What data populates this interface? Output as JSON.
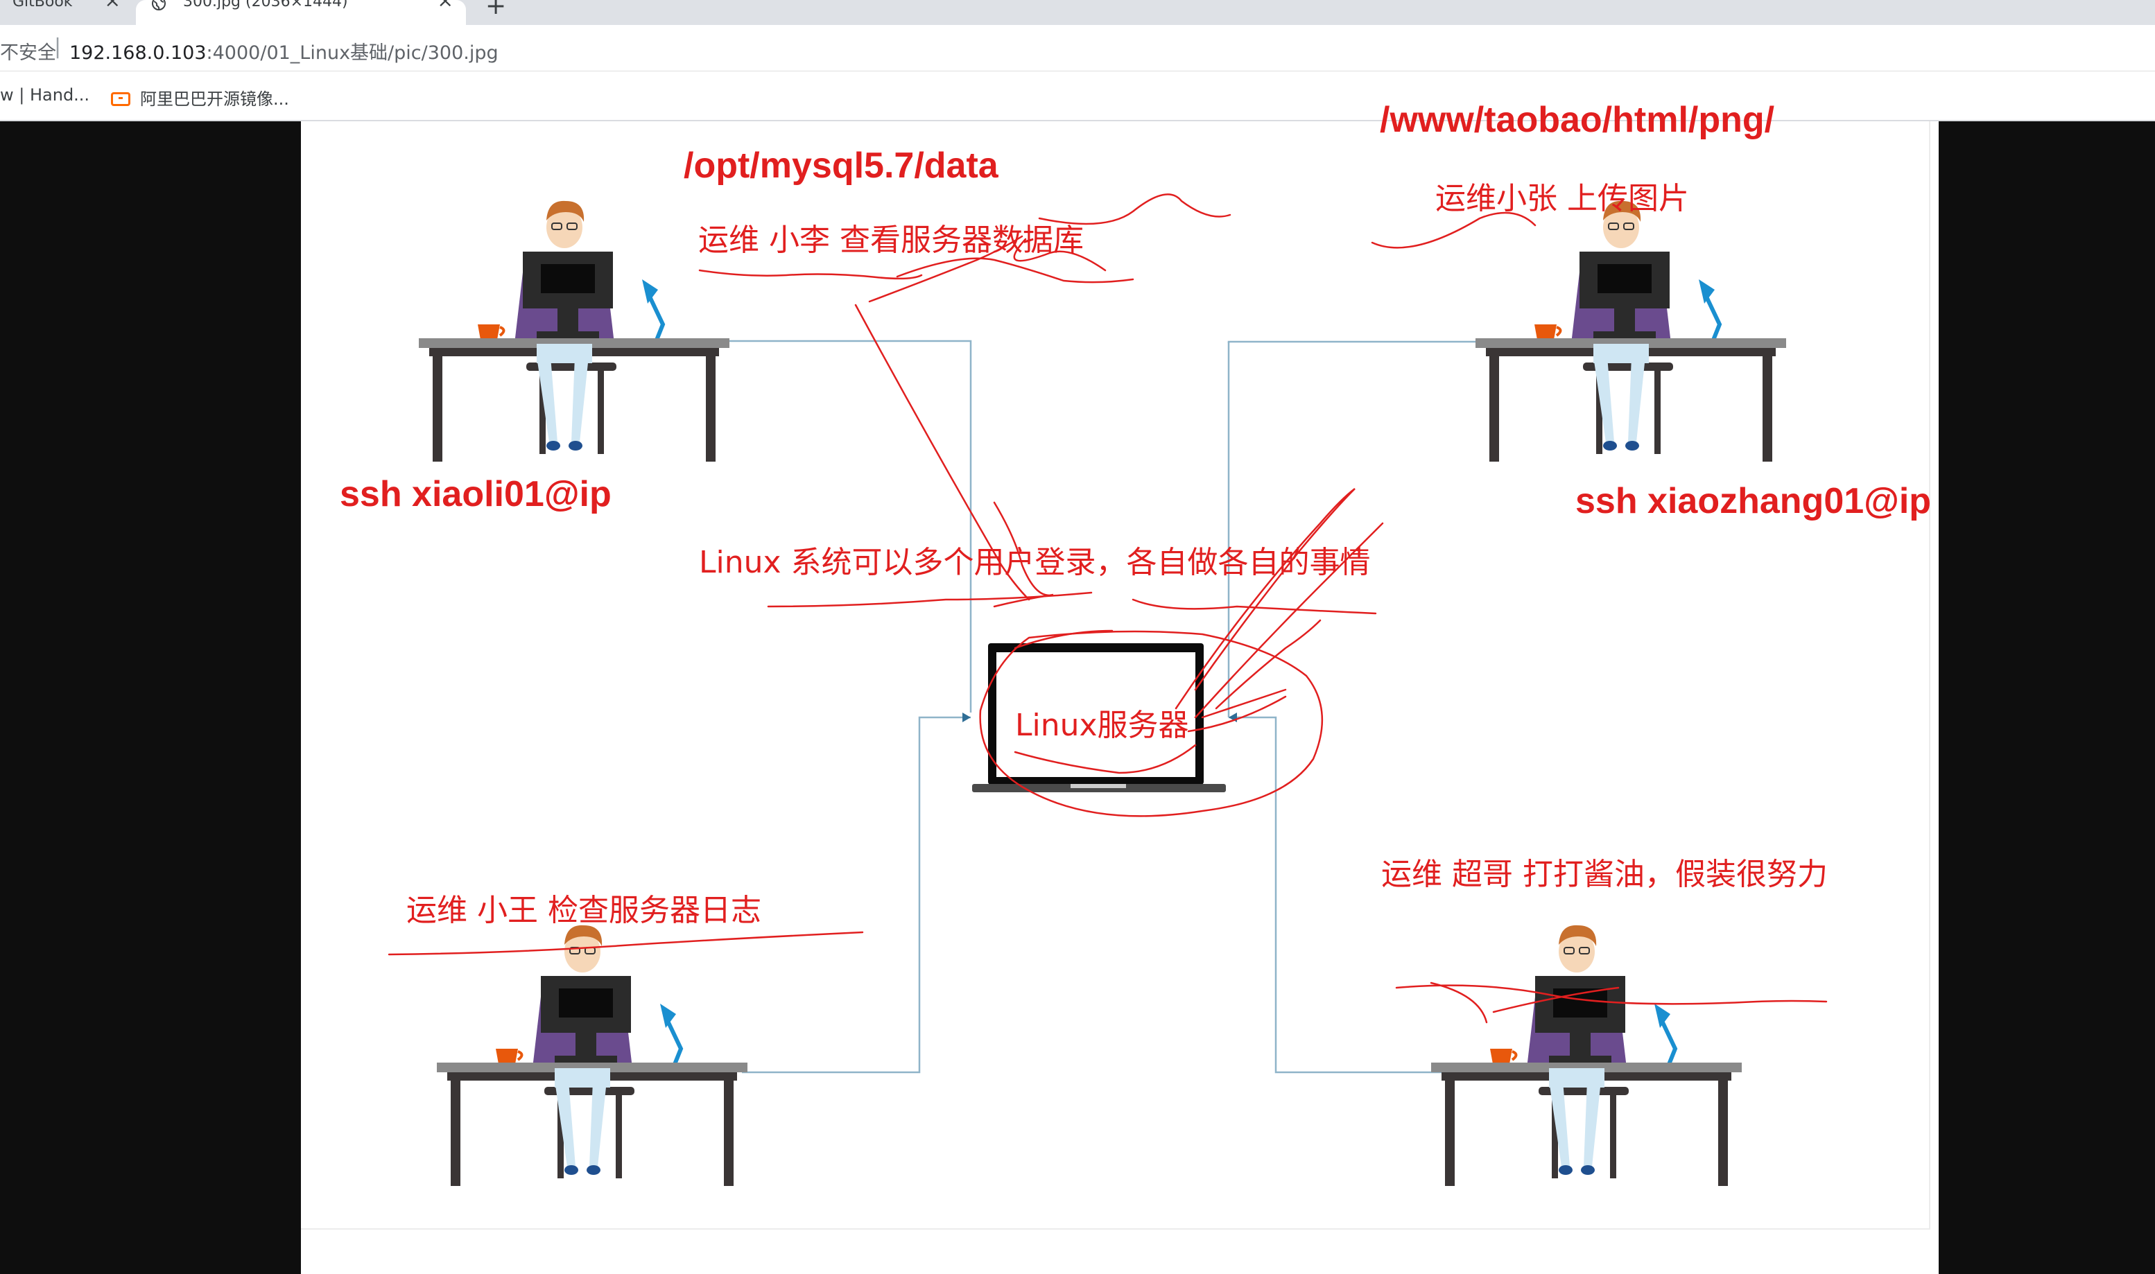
{
  "browser": {
    "tabs": [
      {
        "label": "GitBook",
        "active": false
      },
      {
        "label": "300.jpg (2036×1444)",
        "active": true
      }
    ],
    "tab_close_glyph": "×",
    "new_tab_glyph": "+",
    "security_label": "不安全",
    "separator": "|",
    "url_host": "192.168.0.103",
    "url_rest": ":4000/01_Linux基础/pic/300.jpg",
    "bookmarks": [
      {
        "label": "w | Hand..."
      },
      {
        "label": "阿里巴巴开源镜像..."
      }
    ]
  },
  "image": {
    "annotations": {
      "path_mysql": "/opt/mysql5.7/data",
      "path_www": "/www/taobao/html/png/",
      "ops_li": "运维 小李 查看服务器数据库",
      "ops_zhang": "运维小张 上传图片",
      "ssh_li": "ssh xiaoli01@ip",
      "ssh_zhang": "ssh xiaozhang01@ip",
      "multiuser_note": "Linux 系统可以多个用户登录，各自做各自的事情",
      "server_label": "Linux服务器",
      "ops_wang": "运维 小王 检查服务器日志",
      "ops_chao": "运维 超哥 打打酱油，假装很努力"
    },
    "colors": {
      "annotation": "#e11f1f",
      "connector": "#8fb4c9",
      "desk": "#3a3535",
      "desktop": "#8a8a8a",
      "lamp": "#1a8fd0",
      "cup": "#e8580c",
      "shirt": "#6a4b8e",
      "pants": "#cfe6f3",
      "hair": "#c8702e"
    }
  }
}
